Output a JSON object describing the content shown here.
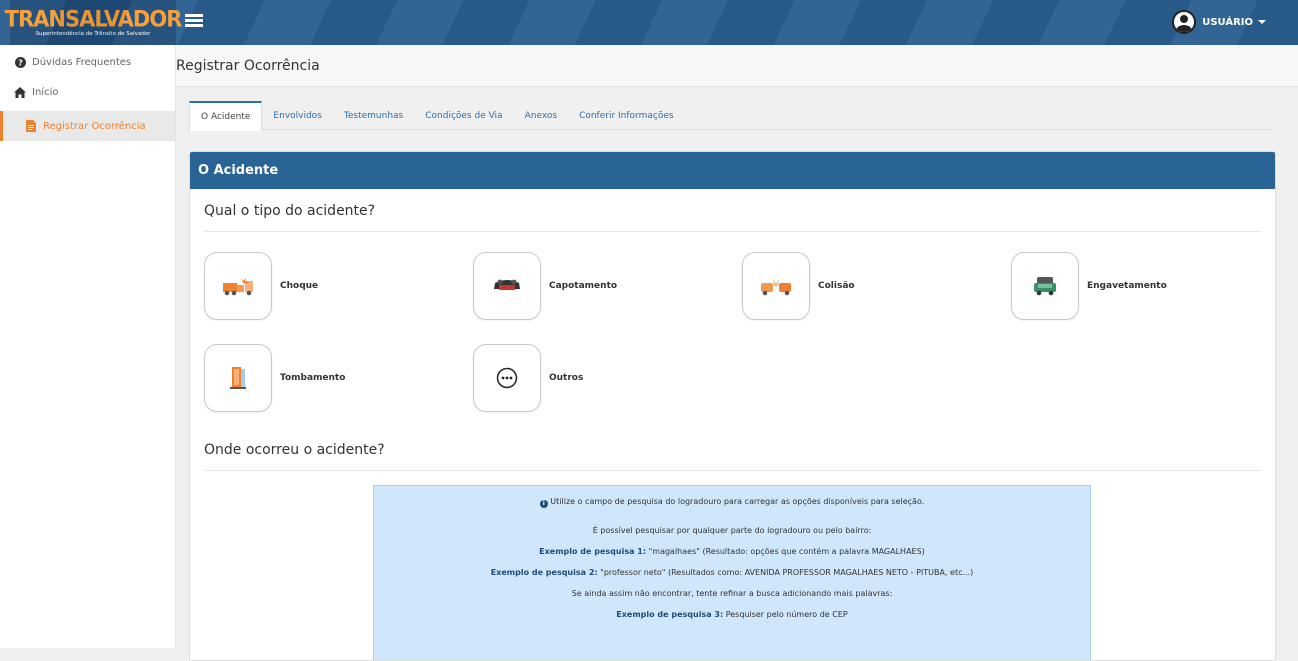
{
  "brand": {
    "name": "TRANSALVADOR",
    "subtitle": "Superintendência de Trânsito de Salvador",
    "accent_color": "#f39c35",
    "bar_color": "#2a5f90"
  },
  "header": {
    "menu_icon": "list-icon",
    "user_label": "USUÁRIO"
  },
  "sidebar": {
    "items": [
      {
        "label": "Dúvidas Frequentes",
        "icon": "question-circle-icon"
      },
      {
        "label": "Início",
        "icon": "home-icon"
      },
      {
        "label": "Registrar Ocorrência",
        "icon": "document-icon",
        "active": true
      }
    ],
    "active_color": "#f0822f"
  },
  "page": {
    "title": "Registrar Ocorrência"
  },
  "tabs": [
    {
      "label": "O Acidente",
      "active": true
    },
    {
      "label": "Envolvidos"
    },
    {
      "label": "Testemunhas"
    },
    {
      "label": "Condições de Via"
    },
    {
      "label": "Anexos"
    },
    {
      "label": "Conferir Informações"
    }
  ],
  "panel": {
    "title": "O Acidente",
    "question_type": "Qual o tipo do acidente?",
    "question_location": "Onde ocorreu o acidente?",
    "options": [
      {
        "label": "Choque",
        "icon": "truck-crash-icon"
      },
      {
        "label": "Capotamento",
        "icon": "overturned-car-icon"
      },
      {
        "label": "Colisão",
        "icon": "collision-icon"
      },
      {
        "label": "Engavetamento",
        "icon": "pileup-icon"
      },
      {
        "label": "Tombamento",
        "icon": "tipped-truck-icon"
      },
      {
        "label": "Outros",
        "icon": "more-circle-icon"
      }
    ]
  },
  "info": {
    "line1": "Utilize o campo de pesquisa do logradouro para carregar as opções disponíveis para seleção.",
    "line2": "É possível pesquisar por qualquer parte do logradouro ou pelo bairro:",
    "ex1_label": "Exemplo de pesquisa 1:",
    "ex1_text": " \"magalhaes\" (Resultado: opções que contém a palavra MAGALHAES)",
    "ex2_label": "Exemplo de pesquisa 2:",
    "ex2_text": " \"professor neto\" (Resultados como: AVENIDA PROFESSOR MAGALHAES NETO - PITUBA, etc...)",
    "line3": "Se ainda assim não encontrar, tente refinar a busca adicionando mais palavras:",
    "ex3_label": "Exemplo de pesquisa 3:",
    "ex3_text": " Pesquiser pelo número de CEP"
  }
}
